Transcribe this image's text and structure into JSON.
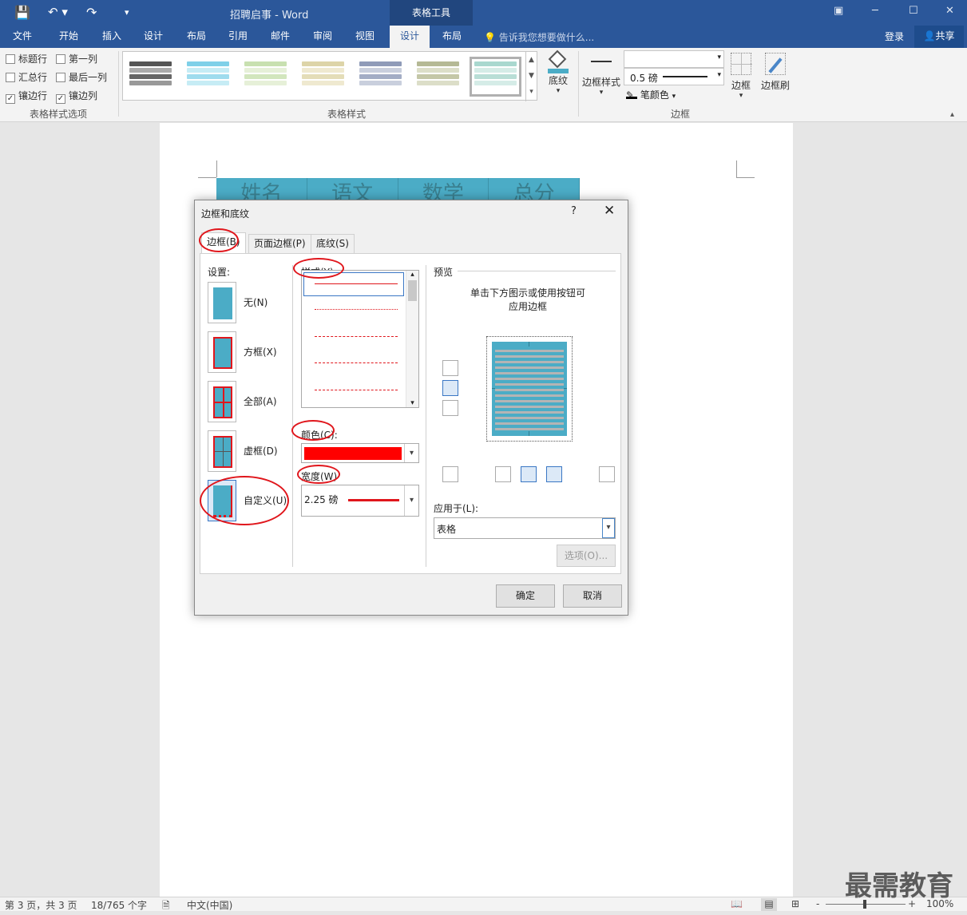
{
  "titlebar": {
    "doc_title": "招聘启事 - Word",
    "context_tab": "表格工具",
    "save": "💾",
    "undo": "↶ ▾",
    "redo": "↷",
    "customize": "▾"
  },
  "window": {
    "restore": "▣",
    "minimize": "─",
    "maximize": "☐",
    "close": "✕"
  },
  "tabs": [
    "文件",
    "开始",
    "插入",
    "设计",
    "布局",
    "引用",
    "邮件",
    "审阅",
    "视图",
    "设计",
    "布局"
  ],
  "tell_me": "告诉我您想要做什么...",
  "login": "登录",
  "share": "共享",
  "ribbon": {
    "options": [
      {
        "label": "标题行",
        "checked": false
      },
      {
        "label": "第一列",
        "checked": false
      },
      {
        "label": "汇总行",
        "checked": false
      },
      {
        "label": "最后一列",
        "checked": false
      },
      {
        "label": "镶边行",
        "checked": true
      },
      {
        "label": "镶边列",
        "checked": true
      }
    ],
    "group_options": "表格样式选项",
    "group_styles": "表格样式",
    "group_borders": "边框",
    "shading": "底纹",
    "border_styles": "边框样式",
    "border_weight": "0.5 磅",
    "pen_color": "笔颜色",
    "borders": "边框",
    "border_painter": "边框刷",
    "check_mark": "✓",
    "scroll": [
      "▲",
      "▼",
      "▾"
    ]
  },
  "document": {
    "header_cells": [
      "姓名",
      "语文",
      "数学",
      "总分"
    ]
  },
  "dialog": {
    "title": "边框和底纹",
    "help": "?",
    "close": "✕",
    "tabs": [
      "边框(B)",
      "页面边框(P)",
      "底纹(S)"
    ],
    "setting_label": "设置:",
    "settings": [
      "无(N)",
      "方框(X)",
      "全部(A)",
      "虚框(D)",
      "自定义(U)"
    ],
    "style_label": "样式(Y):",
    "color_label": "颜色(C):",
    "width_label": "宽度(W)",
    "width_value": "2.25 磅",
    "preview_label": "预览",
    "preview_hint_1": "单击下方图示或使用按钮可",
    "preview_hint_2": "应用边框",
    "apply_label": "应用于(L):",
    "apply_value": "表格",
    "options_btn": "选项(O)...",
    "ok": "确定",
    "cancel": "取消",
    "arrow_down": "▾",
    "arrow_up": "▴"
  },
  "status": {
    "page": "第 3 页，共 3 页",
    "words": "18/765 个字",
    "lang": "中文(中国)",
    "zoom": "100%",
    "minus": "-",
    "plus": "+"
  },
  "watermark": "最需教育",
  "colors": {
    "brand": "#2b579a",
    "table": "#4bacc6",
    "accent_red": "#ff0000"
  }
}
